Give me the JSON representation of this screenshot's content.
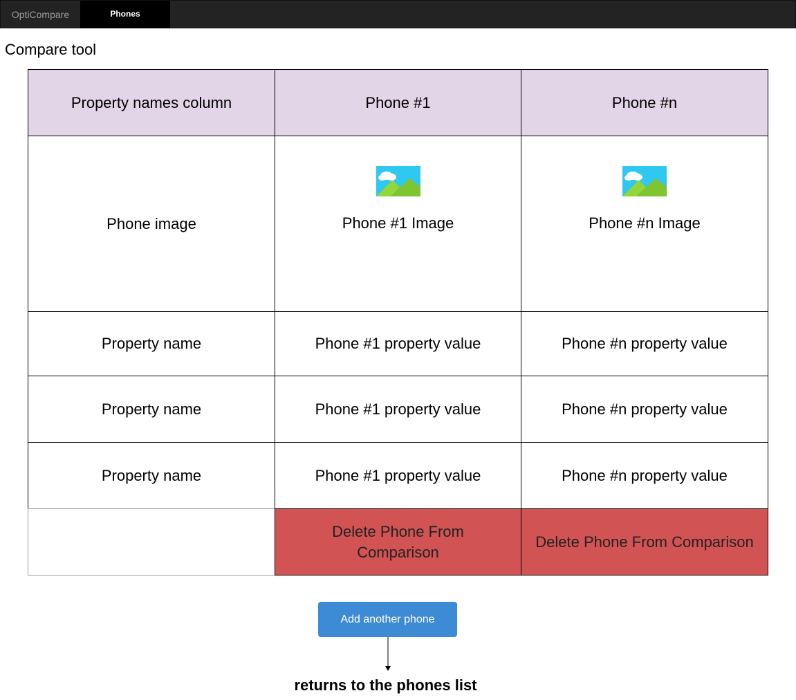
{
  "nav": {
    "brand": "OptiCompare",
    "active_tab": "Phones"
  },
  "page": {
    "title": "Compare tool"
  },
  "table": {
    "headers": [
      "Property names column",
      "Phone #1",
      "Phone #n"
    ],
    "image_row": {
      "label": "Phone image",
      "captions": [
        "Phone #1 Image",
        "Phone #n Image"
      ]
    },
    "property_rows": [
      {
        "name": "Property name",
        "values": [
          "Phone #1 property value",
          "Phone #n property value"
        ]
      },
      {
        "name": "Property name",
        "values": [
          "Phone #1 property value",
          "Phone #n property value"
        ]
      },
      {
        "name": "Property name",
        "values": [
          "Phone #1 property value",
          "Phone #n property value"
        ]
      }
    ],
    "delete_label": "Delete Phone From Comparison"
  },
  "actions": {
    "add_label": "Add another phone",
    "note": "returns to the phones list"
  },
  "icons": {
    "phone_image": "image-placeholder-icon"
  },
  "colors": {
    "header_bg": "#e1d5e7",
    "delete_bg": "#d25353",
    "button_bg": "#3d8bd4",
    "topbar_bg": "#232323"
  }
}
